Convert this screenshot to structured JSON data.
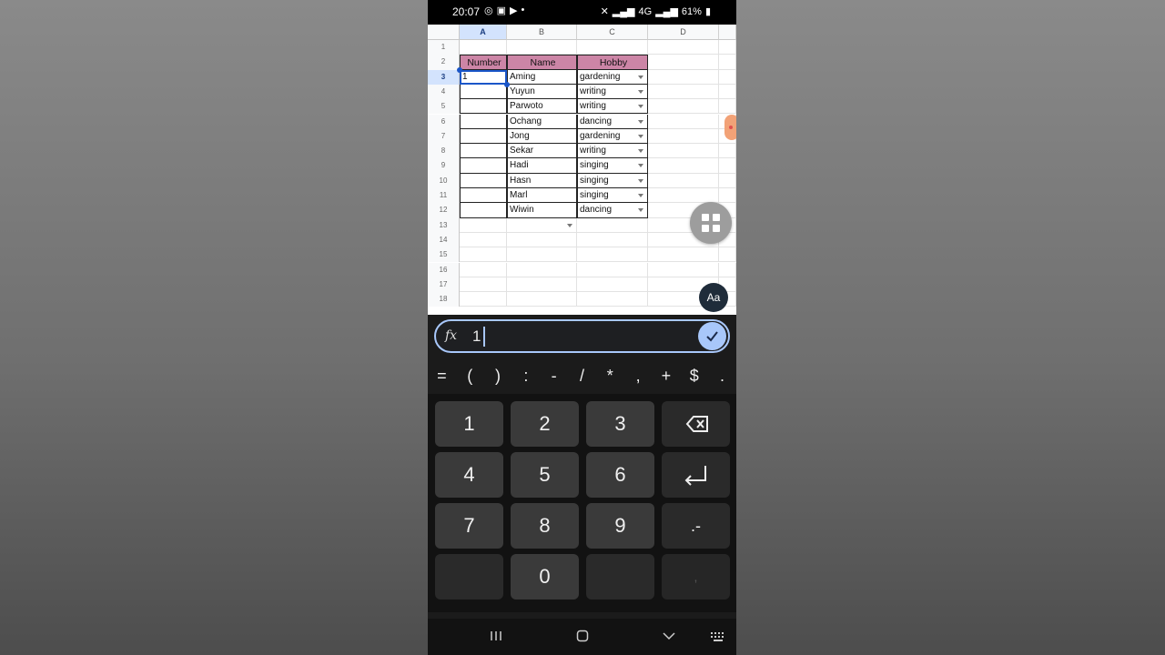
{
  "status_bar": {
    "time": "20:07",
    "battery_percent": "61%",
    "network": "4G"
  },
  "sheet": {
    "columns": [
      "A",
      "B",
      "C",
      "D"
    ],
    "active_column": "A",
    "rows": [
      "1",
      "2",
      "3",
      "4",
      "5",
      "6",
      "7",
      "8",
      "9",
      "10",
      "11",
      "12",
      "13",
      "14",
      "15",
      "16",
      "17",
      "18"
    ],
    "active_row": "3",
    "table_headers": [
      "Number",
      "Name",
      "Hobby"
    ],
    "table_rows": [
      {
        "number": "1",
        "name": "Aming",
        "hobby": "gardening"
      },
      {
        "number": "",
        "name": "Yuyun",
        "hobby": "writing"
      },
      {
        "number": "",
        "name": "Parwoto",
        "hobby": "writing"
      },
      {
        "number": "",
        "name": "Ochang",
        "hobby": "dancing"
      },
      {
        "number": "",
        "name": "Jong",
        "hobby": "gardening"
      },
      {
        "number": "",
        "name": "Sekar",
        "hobby": "writing"
      },
      {
        "number": "",
        "name": "Hadi",
        "hobby": "singing"
      },
      {
        "number": "",
        "name": "Hasn",
        "hobby": "singing"
      },
      {
        "number": "",
        "name": "Marl",
        "hobby": "singing"
      },
      {
        "number": "",
        "name": "Wiwin",
        "hobby": "dancing"
      }
    ]
  },
  "format_button": {
    "label": "Aa"
  },
  "formula_bar": {
    "fx_label": "fx",
    "value": "1"
  },
  "symbol_row": [
    "=",
    "(",
    ")",
    ":",
    "-",
    "/",
    "*",
    ",",
    "+",
    "$",
    "."
  ],
  "keypad": {
    "keys": [
      "1",
      "2",
      "3",
      "4",
      "5",
      "6",
      "7",
      "8",
      "9",
      "0"
    ],
    "decimal_minus": ".-",
    "comma_key": ","
  },
  "colors": {
    "header_fill": "#cc85a6",
    "selection": "#1a56c9",
    "accent": "#a8c7fa"
  }
}
